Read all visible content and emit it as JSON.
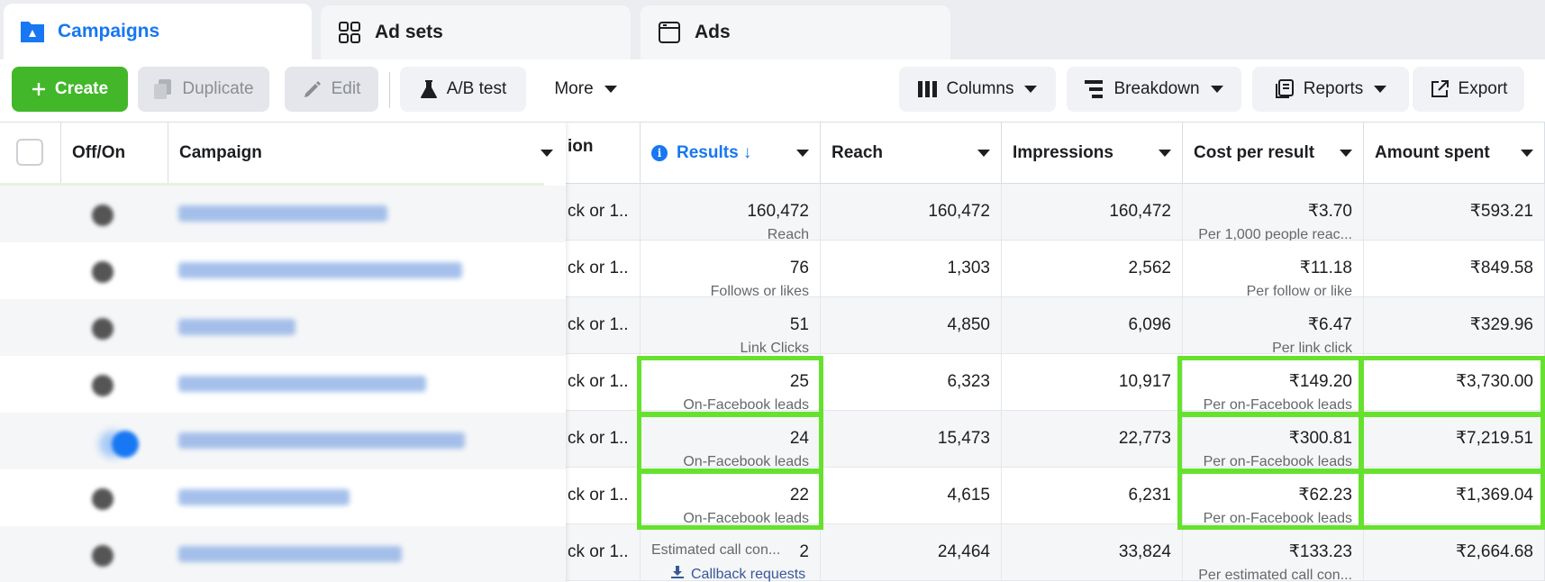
{
  "tabs": [
    {
      "label": "Campaigns",
      "icon": "campaigns-folder-icon",
      "active": true
    },
    {
      "label": "Ad sets",
      "icon": "adsets-grid-icon",
      "active": false
    },
    {
      "label": "Ads",
      "icon": "ads-window-icon",
      "active": false
    }
  ],
  "toolbar": {
    "create": "Create",
    "duplicate": "Duplicate",
    "edit": "Edit",
    "ab_test": "A/B test",
    "more": "More",
    "columns": "Columns",
    "breakdown": "Breakdown",
    "reports": "Reports",
    "export": "Export"
  },
  "headers": {
    "off_on": "Off/On",
    "campaign": "Campaign",
    "attribution_partial": "ion",
    "results": "Results ↓",
    "reach": "Reach",
    "impressions": "Impressions",
    "cost_per_result": "Cost per result",
    "amount_spent": "Amount spent"
  },
  "rows": [
    {
      "attr": "ck or 1...",
      "result": "160,472",
      "result_type": "Reach",
      "reach": "160,472",
      "impressions": "160,472",
      "cost": "₹3.70",
      "cost_type": "Per 1,000 people reac...",
      "spent": "₹593.21",
      "toggle_on": false
    },
    {
      "attr": "ck or 1...",
      "result": "76",
      "result_type": "Follows or likes",
      "reach": "1,303",
      "impressions": "2,562",
      "cost": "₹11.18",
      "cost_type": "Per follow or like",
      "spent": "₹849.58",
      "toggle_on": false
    },
    {
      "attr": "ck or 1...",
      "result": "51",
      "result_type": "Link Clicks",
      "reach": "4,850",
      "impressions": "6,096",
      "cost": "₹6.47",
      "cost_type": "Per link click",
      "spent": "₹329.96",
      "toggle_on": false
    },
    {
      "attr": "ck or 1...",
      "result": "25",
      "result_type": "On-Facebook leads",
      "reach": "6,323",
      "impressions": "10,917",
      "cost": "₹149.20",
      "cost_type": "Per on-Facebook leads",
      "spent": "₹3,730.00",
      "toggle_on": false
    },
    {
      "attr": "ck or 1...",
      "result": "24",
      "result_type": "On-Facebook leads",
      "reach": "15,473",
      "impressions": "22,773",
      "cost": "₹300.81",
      "cost_type": "Per on-Facebook leads",
      "spent": "₹7,219.51",
      "toggle_on": true
    },
    {
      "attr": "ck or 1...",
      "result": "22",
      "result_type": "On-Facebook leads",
      "reach": "4,615",
      "impressions": "6,231",
      "cost": "₹62.23",
      "cost_type": "Per on-Facebook leads",
      "spent": "₹1,369.04",
      "toggle_on": false
    },
    {
      "attr": "ck or 1...",
      "result": "2",
      "result_type": "Estimated call con...",
      "result_link": "Callback requests",
      "reach": "24,464",
      "impressions": "33,824",
      "cost": "₹133.23",
      "cost_type": "Per estimated call con...",
      "spent": "₹2,664.68",
      "toggle_on": false
    }
  ],
  "colors": {
    "accent": "#1877f2",
    "create": "#42b72a",
    "highlight": "#66e22e"
  }
}
